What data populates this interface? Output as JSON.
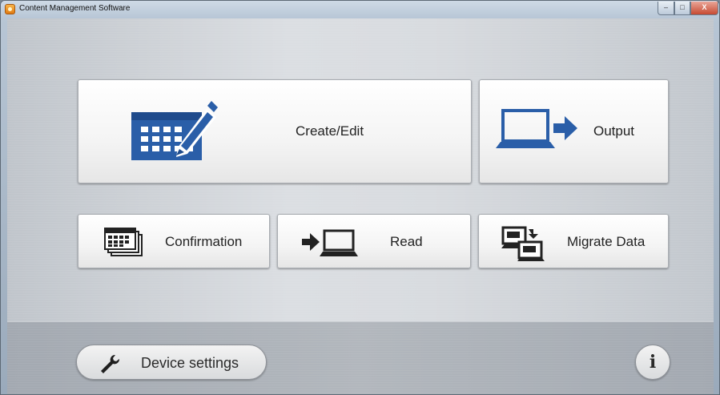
{
  "window": {
    "title": "Content Management Software",
    "app_icon": "app-logo-icon",
    "controls": {
      "minimize": "–",
      "maximize": "□",
      "close": "X"
    }
  },
  "menu": {
    "create_edit": {
      "label": "Create/Edit",
      "icon": "calendar-edit-icon",
      "icon_color": "#2a5ea8"
    },
    "output": {
      "label": "Output",
      "icon": "laptop-arrow-out-icon",
      "icon_color": "#2a5ea8"
    },
    "confirmation": {
      "label": "Confirmation",
      "icon": "stacked-calendars-icon"
    },
    "read": {
      "label": "Read",
      "icon": "arrow-into-laptop-icon"
    },
    "migrate_data": {
      "label": "Migrate Data",
      "icon": "migrate-folders-icon"
    }
  },
  "footer": {
    "device_settings": {
      "label": "Device settings",
      "icon": "wrench-icon"
    },
    "info": {
      "label": "i",
      "icon": "info-icon"
    }
  }
}
